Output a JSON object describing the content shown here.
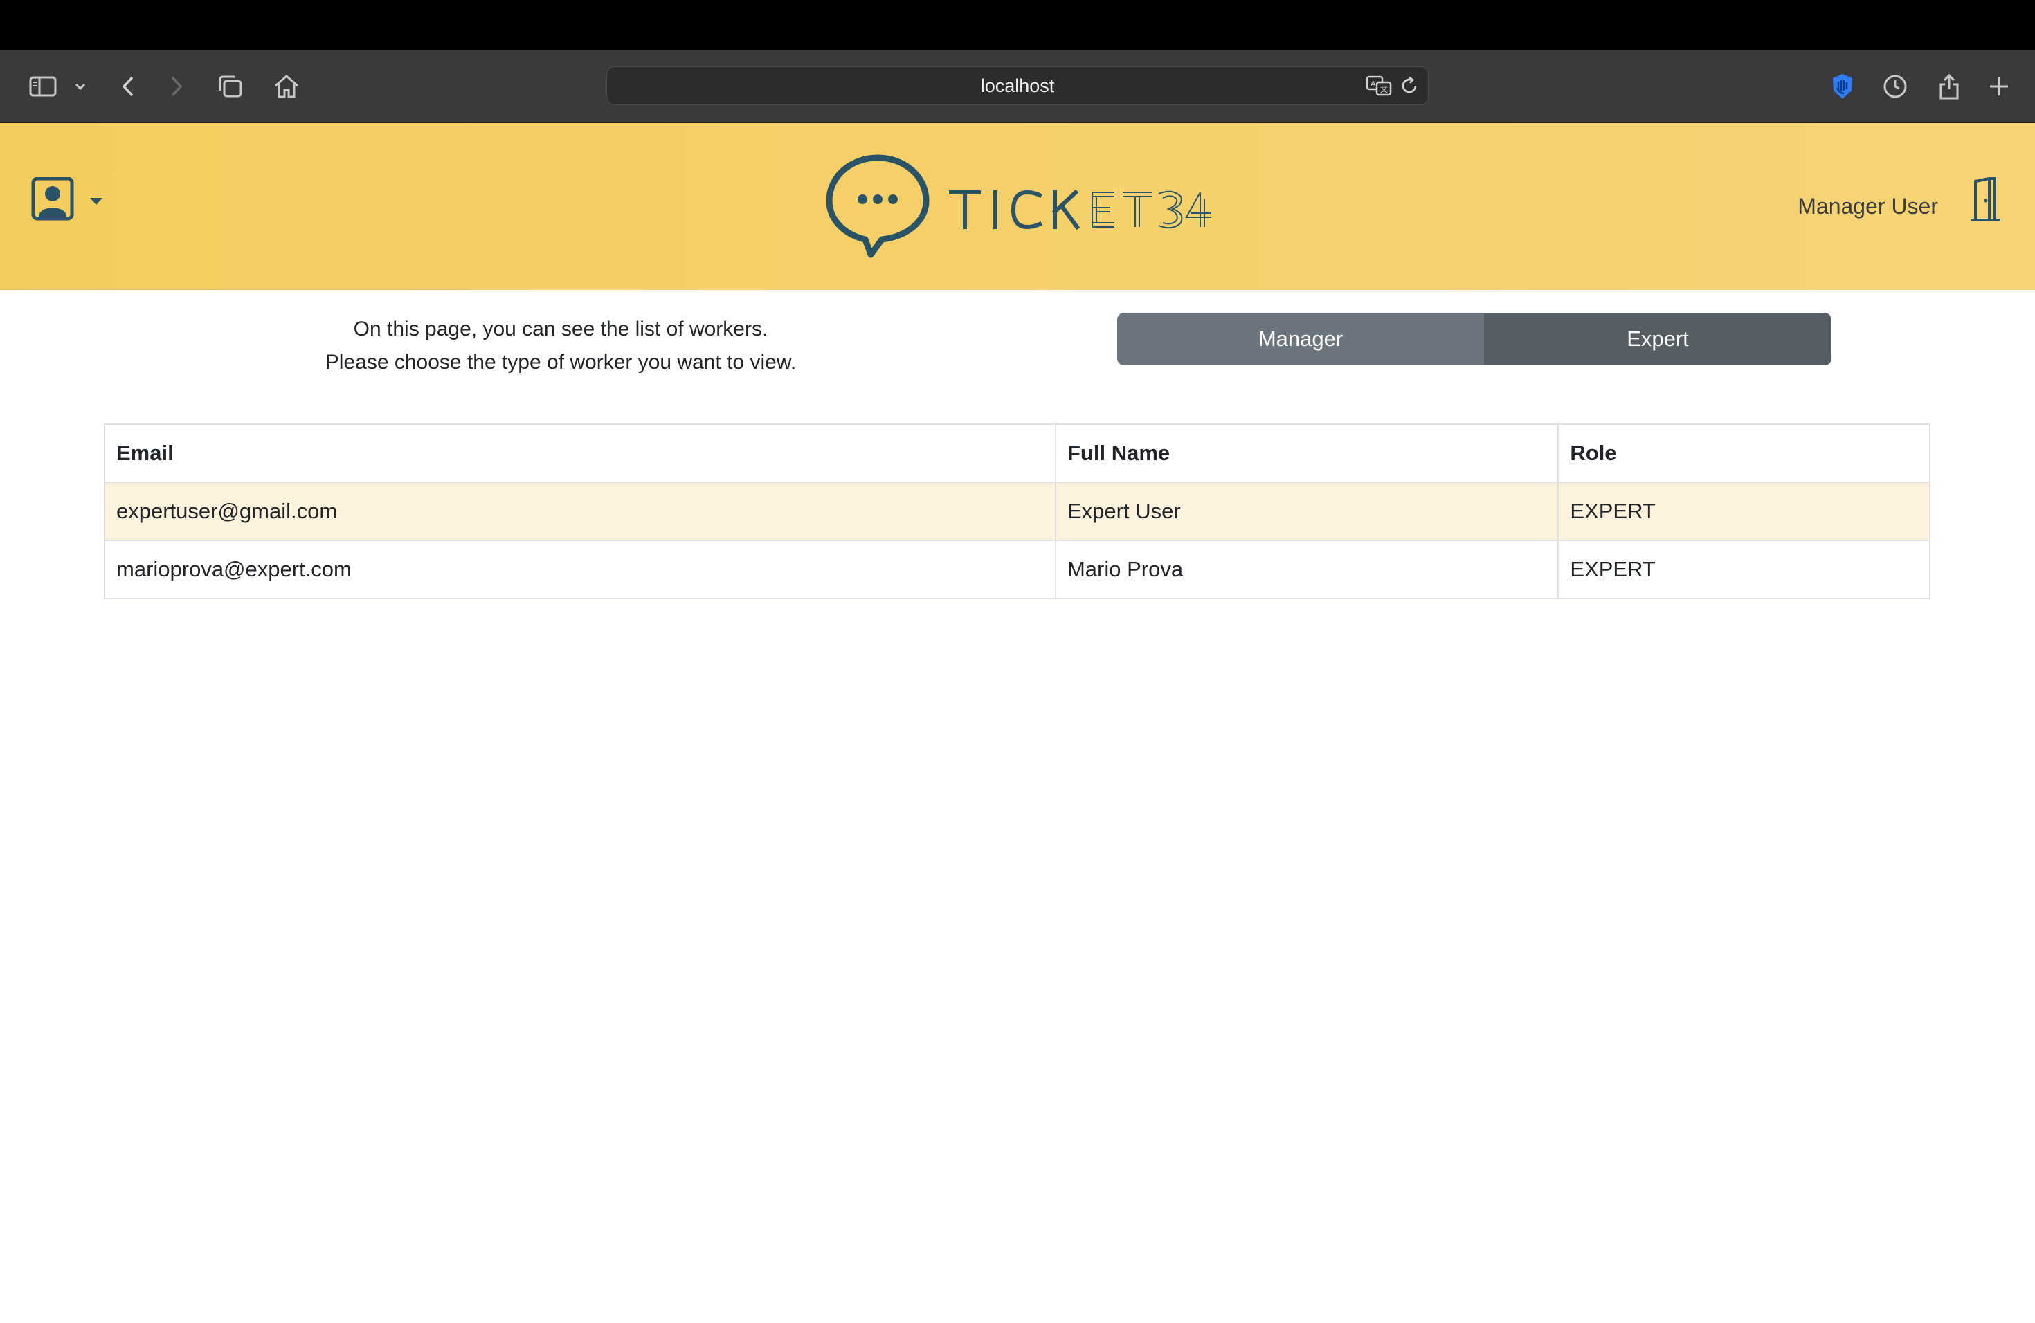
{
  "browser": {
    "url": "localhost"
  },
  "header": {
    "logo_text": "TICKET34",
    "user_name": "Manager User"
  },
  "intro": {
    "line1": "On this page, you can see the list of workers.",
    "line2": "Please choose the type of worker you want to view."
  },
  "worker_type_toggle": {
    "options": [
      "Manager",
      "Expert"
    ],
    "selected": "Expert"
  },
  "table": {
    "columns": [
      "Email",
      "Full Name",
      "Role"
    ],
    "rows": [
      {
        "email": "expertuser@gmail.com",
        "full_name": "Expert User",
        "role": "EXPERT"
      },
      {
        "email": "marioprova@expert.com",
        "full_name": "Mario Prova",
        "role": "EXPERT"
      }
    ]
  },
  "colors": {
    "header_bg": "#f5d06a",
    "brand_dark": "#2b5366",
    "segment_manager": "#6c757d",
    "segment_expert_active": "#565e64",
    "row_highlight": "#fdf3dd"
  }
}
